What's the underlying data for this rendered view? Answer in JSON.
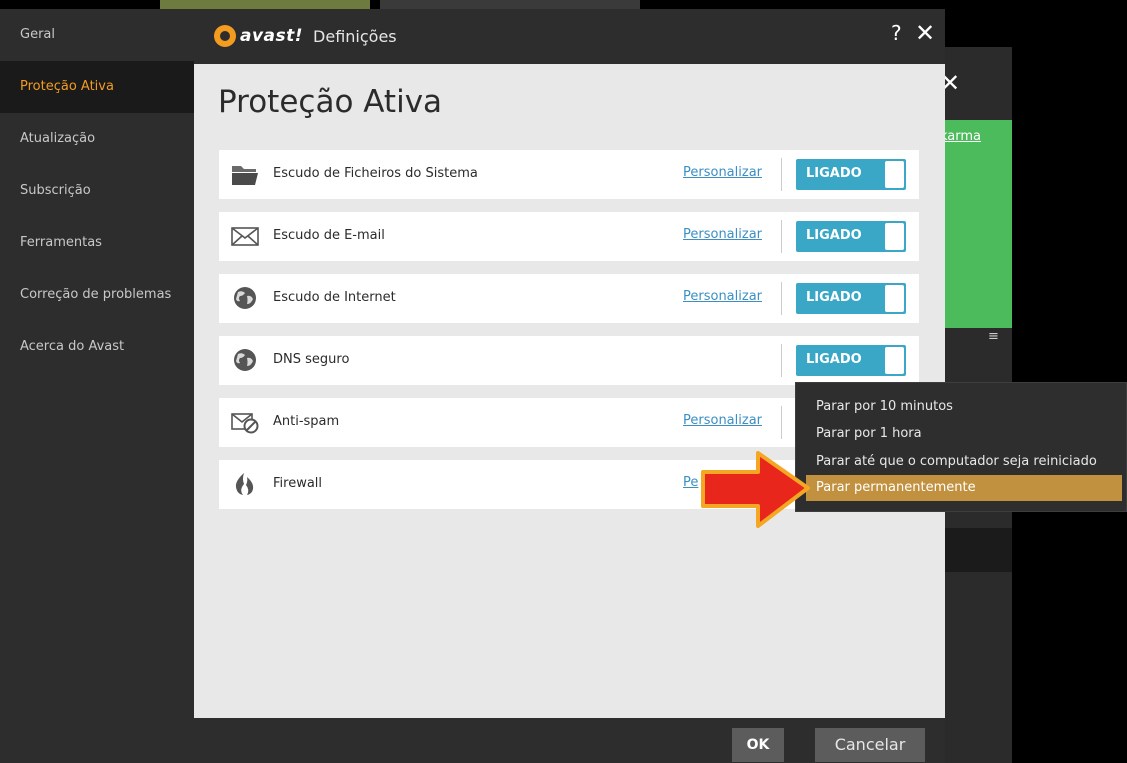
{
  "app": {
    "brand": "avast!",
    "window_title": "Definições",
    "help_label": "?",
    "close_label": "✕"
  },
  "sidebar": {
    "items": [
      {
        "label": "Geral"
      },
      {
        "label": "Proteção Ativa",
        "active": true
      },
      {
        "label": "Atualização"
      },
      {
        "label": "Subscrição"
      },
      {
        "label": "Ferramentas"
      },
      {
        "label": "Correção de problemas"
      },
      {
        "label": "Acerca do Avast"
      }
    ]
  },
  "main": {
    "heading": "Proteção Ativa",
    "shields": [
      {
        "name": "Escudo de Ficheiros do Sistema",
        "icon": "folder-icon",
        "customize": "Personalizar",
        "state": "LIGADO"
      },
      {
        "name": "Escudo de E-mail",
        "icon": "mail-icon",
        "customize": "Personalizar",
        "state": "LIGADO"
      },
      {
        "name": "Escudo de Internet",
        "icon": "globe-icon",
        "customize": "Personalizar",
        "state": "LIGADO"
      },
      {
        "name": "DNS seguro",
        "icon": "globe-icon",
        "customize": "",
        "state": "LIGADO"
      },
      {
        "name": "Anti-spam",
        "icon": "mail-blocked-icon",
        "customize": "Personalizar",
        "state": "LIGADO"
      },
      {
        "name": "Firewall",
        "icon": "flame-icon",
        "customize": "Pe",
        "state": ""
      }
    ]
  },
  "toggle_menu": {
    "items": [
      {
        "label": "Parar por 10 minutos"
      },
      {
        "label": "Parar por 1 hora"
      },
      {
        "label": "Parar até que o computador seja reiniciado"
      },
      {
        "label": "Parar permanentemente",
        "highlighted": true
      }
    ]
  },
  "footer": {
    "ok_label": "OK",
    "cancel_label": "Cancelar"
  },
  "background_window": {
    "min_label": "_",
    "close_label": "✕",
    "link_text": "karma",
    "list_icon": "list-icon"
  },
  "colors": {
    "accent_orange": "#f39c1f",
    "toggle_blue": "#3aa7c7",
    "menu_highlight": "#c2913f",
    "arrow_red": "#e8261c",
    "green_panel": "#4cbb5b"
  }
}
